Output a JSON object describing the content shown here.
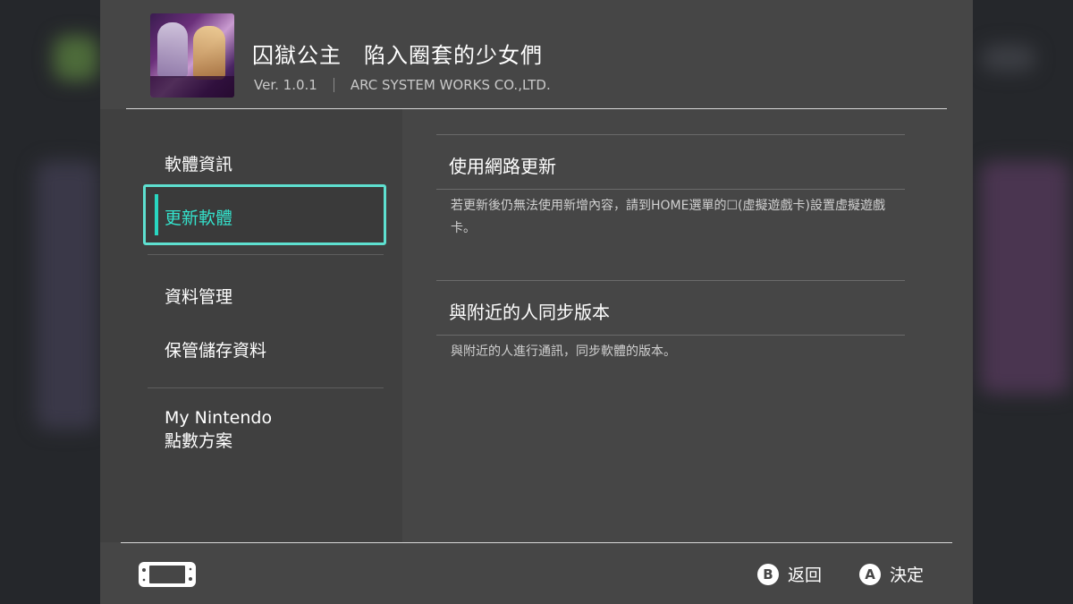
{
  "header": {
    "title": "囚獄公主　陷入圈套的少女們",
    "version": "Ver. 1.0.1",
    "publisher": "ARC SYSTEM WORKS CO.,LTD."
  },
  "sidebar": {
    "items": [
      {
        "label": "軟體資訊",
        "selected": false
      },
      {
        "label": "更新軟體",
        "selected": true
      },
      {
        "label": "資料管理",
        "selected": false
      },
      {
        "label": "保管儲存資料",
        "selected": false
      }
    ],
    "nintendo": {
      "line1": "My Nintendo",
      "line2": "點數方案"
    }
  },
  "main": {
    "sections": [
      {
        "title": "使用網路更新",
        "description": "若更新後仍無法使用新增內容，請到HOME選單的☐(虛擬遊戲卡)設置虛擬遊戲卡。"
      },
      {
        "title": "與附近的人同步版本",
        "description": "與附近的人進行通訊，同步軟體的版本。"
      }
    ]
  },
  "footer": {
    "back": {
      "button": "B",
      "label": "返回"
    },
    "confirm": {
      "button": "A",
      "label": "決定"
    }
  },
  "colors": {
    "accent": "#5ee0d0",
    "panel": "#464646",
    "sidebar": "#404040"
  }
}
